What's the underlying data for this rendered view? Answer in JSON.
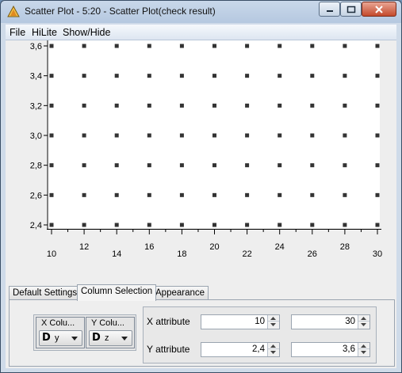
{
  "window": {
    "title": "Scatter Plot - 5:20 - Scatter Plot(check result)"
  },
  "menu": {
    "items": [
      "File",
      "HiLite",
      "Show/Hide"
    ]
  },
  "chart_data": {
    "type": "scatter",
    "x_ticks": [
      10,
      12,
      14,
      16,
      18,
      20,
      22,
      24,
      26,
      28,
      30
    ],
    "y_ticks": [
      "2,4",
      "2,6",
      "2,8",
      "3,0",
      "3,2",
      "3,4",
      "3,6"
    ],
    "xlim": [
      10,
      30
    ],
    "ylim": [
      2.4,
      3.6
    ],
    "x_values": [
      10,
      12,
      14,
      16,
      18,
      20,
      22,
      24,
      26,
      28,
      30
    ],
    "y_values": [
      2.4,
      2.6,
      2.8,
      3.0,
      3.2,
      3.4,
      3.6
    ],
    "grid": false,
    "point_color": "#333333"
  },
  "tabs": [
    "Default Settings",
    "Column Selection",
    "Appearance"
  ],
  "active_tab": "Column Selection",
  "columns": {
    "x": {
      "label": "X Colu...",
      "badge": "D",
      "value": "y"
    },
    "y": {
      "label": "Y Colu...",
      "badge": "D",
      "value": "z"
    }
  },
  "ranges": {
    "x_label": "X attribute",
    "y_label": "Y attribute",
    "x_min": "10",
    "x_max": "30",
    "y_min": "2,4",
    "y_max": "3,6"
  }
}
